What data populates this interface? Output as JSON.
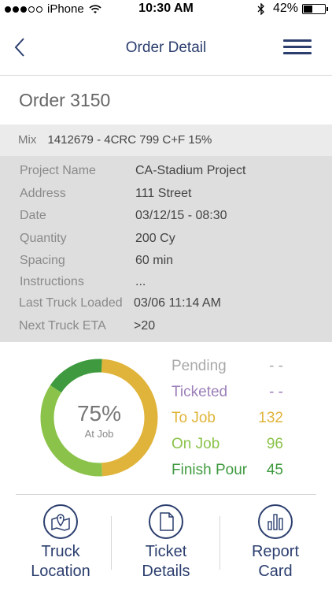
{
  "status_bar": {
    "carrier": "iPhone",
    "time": "10:30 AM",
    "battery": "42%",
    "battery_level": 0.42,
    "icons": [
      "signal-dots-icon",
      "wifi-icon",
      "bluetooth-icon",
      "battery-icon"
    ]
  },
  "nav": {
    "title": "Order Detail",
    "back_icon": "chevron-left-icon",
    "menu_icon": "hamburger-menu-icon"
  },
  "order": {
    "title": "Order 3150",
    "mix_label": "Mix",
    "mix_value": "1412679 - 4CRC 799 C+F 15%"
  },
  "details": [
    {
      "label": "Project Name",
      "value": "CA-Stadium Project"
    },
    {
      "label": "Address",
      "value": "111 Street"
    },
    {
      "label": "Date",
      "value": "03/12/15 - 08:30"
    },
    {
      "label": "Quantity",
      "value": "200 Cy"
    },
    {
      "label": "Spacing",
      "value": "60 min"
    },
    {
      "label": "Instructions",
      "value": "..."
    },
    {
      "label": "Last Truck Loaded",
      "value": "03/06 11:14 AM"
    },
    {
      "label": "Next Truck ETA",
      "value": ">20"
    }
  ],
  "progress": {
    "percent": "75%",
    "percent_value": 75,
    "caption": "At Job"
  },
  "legend": [
    {
      "label": "Pending",
      "value": "- -",
      "color": "#a9a9a9"
    },
    {
      "label": "Ticketed",
      "value": "- -",
      "color": "#9b7fb8"
    },
    {
      "label": "To Job",
      "value": "132",
      "color": "#e0b43a"
    },
    {
      "label": "On Job",
      "value": "96",
      "color": "#8bc34a"
    },
    {
      "label": "Finish Pour",
      "value": "45",
      "color": "#3f9a3f"
    }
  ],
  "chart_data": {
    "type": "pie",
    "categories": [
      "To Job",
      "On Job",
      "Finish Pour"
    ],
    "values": [
      132,
      96,
      45
    ],
    "colors": [
      "#e0b43a",
      "#8bc34a",
      "#3f9a3f"
    ],
    "title": "",
    "center_text": "75%",
    "center_caption": "At Job"
  },
  "tabs": [
    {
      "label_line1": "Truck",
      "label_line2": "Location",
      "icon": "map-pin-icon"
    },
    {
      "label_line1": "Ticket",
      "label_line2": "Details",
      "icon": "document-icon"
    },
    {
      "label_line1": "Report",
      "label_line2": "Card",
      "icon": "bar-chart-icon"
    }
  ],
  "colors": {
    "brand": "#2b3e6e",
    "mix_bg": "#ebebeb",
    "details_bg": "#dedede"
  }
}
